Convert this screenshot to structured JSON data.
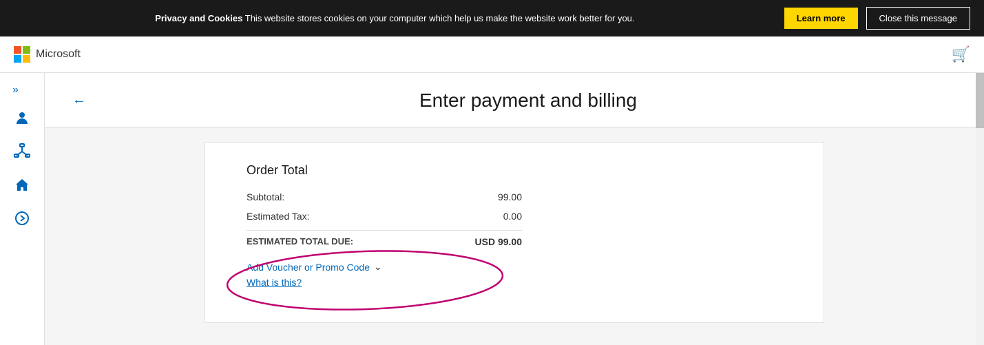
{
  "cookie_banner": {
    "bold_text": "Privacy and Cookies",
    "message": " This website stores cookies on your computer which help us make the website work better for you.",
    "learn_more_label": "Learn more",
    "close_label": "Close this message"
  },
  "header": {
    "logo_name": "Microsoft",
    "cart_icon": "🛒"
  },
  "sidebar": {
    "chevron": "»",
    "icons": [
      "person",
      "network",
      "home",
      "arrow-right"
    ]
  },
  "page": {
    "back_label": "←",
    "title": "Enter payment and billing"
  },
  "order": {
    "section_title": "Order Total",
    "subtotal_label": "Subtotal:",
    "subtotal_value": "99.00",
    "tax_label": "Estimated Tax:",
    "tax_value": "0.00",
    "total_label": "ESTIMATED TOTAL DUE:",
    "total_value": "USD 99.00",
    "voucher_label": "Add Voucher or Promo Code",
    "what_is_this_label": "What is this?"
  }
}
